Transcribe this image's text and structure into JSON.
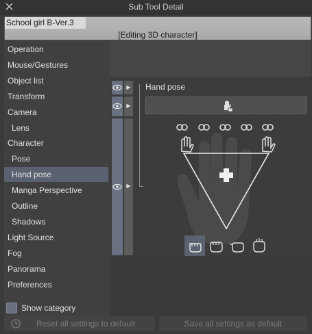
{
  "window": {
    "title": "Sub Tool Detail"
  },
  "subtool": {
    "name": "School girl B-Ver.3",
    "mode": "[Editing 3D character]"
  },
  "sidebar": {
    "items": [
      {
        "label": "Operation",
        "sub": false
      },
      {
        "label": "Mouse/Gestures",
        "sub": false
      },
      {
        "label": "Object list",
        "sub": false
      },
      {
        "label": "Transform",
        "sub": false
      },
      {
        "label": "Camera",
        "sub": false
      },
      {
        "label": "Lens",
        "sub": true
      },
      {
        "label": "Character",
        "sub": false
      },
      {
        "label": "Pose",
        "sub": true
      },
      {
        "label": "Hand pose",
        "sub": true,
        "active": true
      },
      {
        "label": "Manga Perspective",
        "sub": true
      },
      {
        "label": "Outline",
        "sub": true
      },
      {
        "label": "Shadows",
        "sub": true
      },
      {
        "label": "Light Source",
        "sub": false
      },
      {
        "label": "Fog",
        "sub": false
      },
      {
        "label": "Panorama",
        "sub": false
      },
      {
        "label": "Preferences",
        "sub": false
      }
    ],
    "show_category": "Show category"
  },
  "main": {
    "section_label": "Hand pose"
  },
  "footer": {
    "reset_label": "Reset all settings to default",
    "save_label": "Save all settings as default"
  },
  "colors": {
    "accent": "#5a6170",
    "background": "#3a3a3a"
  }
}
